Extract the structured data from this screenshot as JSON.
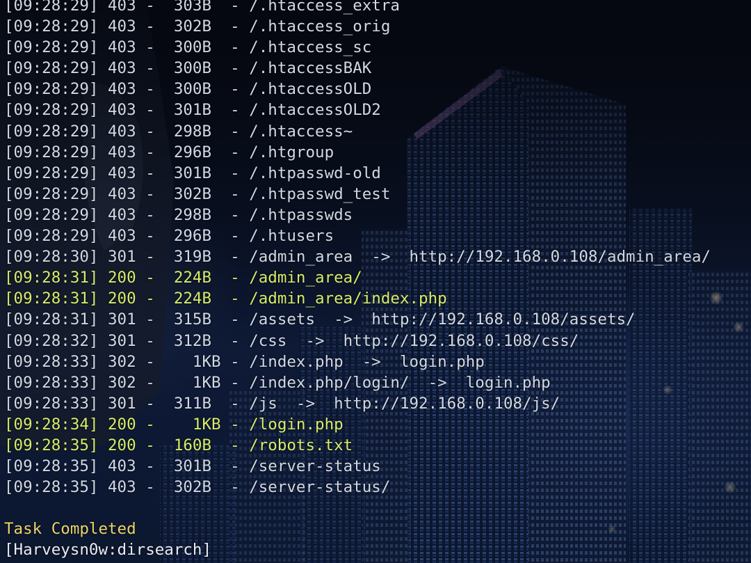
{
  "terminal": {
    "lines": [
      "[09:28:29] 403 -  303B  - /.htaccess_extra",
      "[09:28:29] 403 -  302B  - /.htaccess_orig",
      "[09:28:29] 403 -  300B  - /.htaccess_sc",
      "[09:28:29] 403 -  300B  - /.htaccessBAK",
      "[09:28:29] 403 -  300B  - /.htaccessOLD",
      "[09:28:29] 403 -  301B  - /.htaccessOLD2",
      "[09:28:29] 403 -  298B  - /.htaccess~",
      "[09:28:29] 403 -  296B  - /.htgroup",
      "[09:28:29] 403 -  301B  - /.htpasswd-old",
      "[09:28:29] 403 -  302B  - /.htpasswd_test",
      "[09:28:29] 403 -  298B  - /.htpasswds",
      "[09:28:29] 403 -  296B  - /.htusers",
      "[09:28:30] 301 -  319B  - /admin_area  ->  http://192.168.0.108/admin_area/",
      "[09:28:31] 200 -  224B  - /admin_area/",
      "[09:28:31] 200 -  224B  - /admin_area/index.php",
      "[09:28:31] 301 -  315B  - /assets  ->  http://192.168.0.108/assets/",
      "[09:28:32] 301 -  312B  - /css  ->  http://192.168.0.108/css/",
      "[09:28:33] 302 -    1KB - /index.php  ->  login.php",
      "[09:28:33] 302 -    1KB - /index.php/login/  ->  login.php",
      "[09:28:33] 301 -  311B  - /js  ->  http://192.168.0.108/js/",
      "[09:28:34] 200 -    1KB - /login.php",
      "[09:28:35] 200 -  160B  - /robots.txt",
      "[09:28:35] 403 -  301B  - /server-status",
      "[09:28:35] 403 -  302B  - /server-status/"
    ],
    "task_status": "Task Completed",
    "prompt": "[Harveysn0w:dirsearch]"
  },
  "colors": {
    "default_text": "#d2d9e6",
    "success_200": "#d7ec6a",
    "task_completed": "#ecd56c",
    "prompt": "#e9edf4",
    "background": "#0a1226"
  }
}
